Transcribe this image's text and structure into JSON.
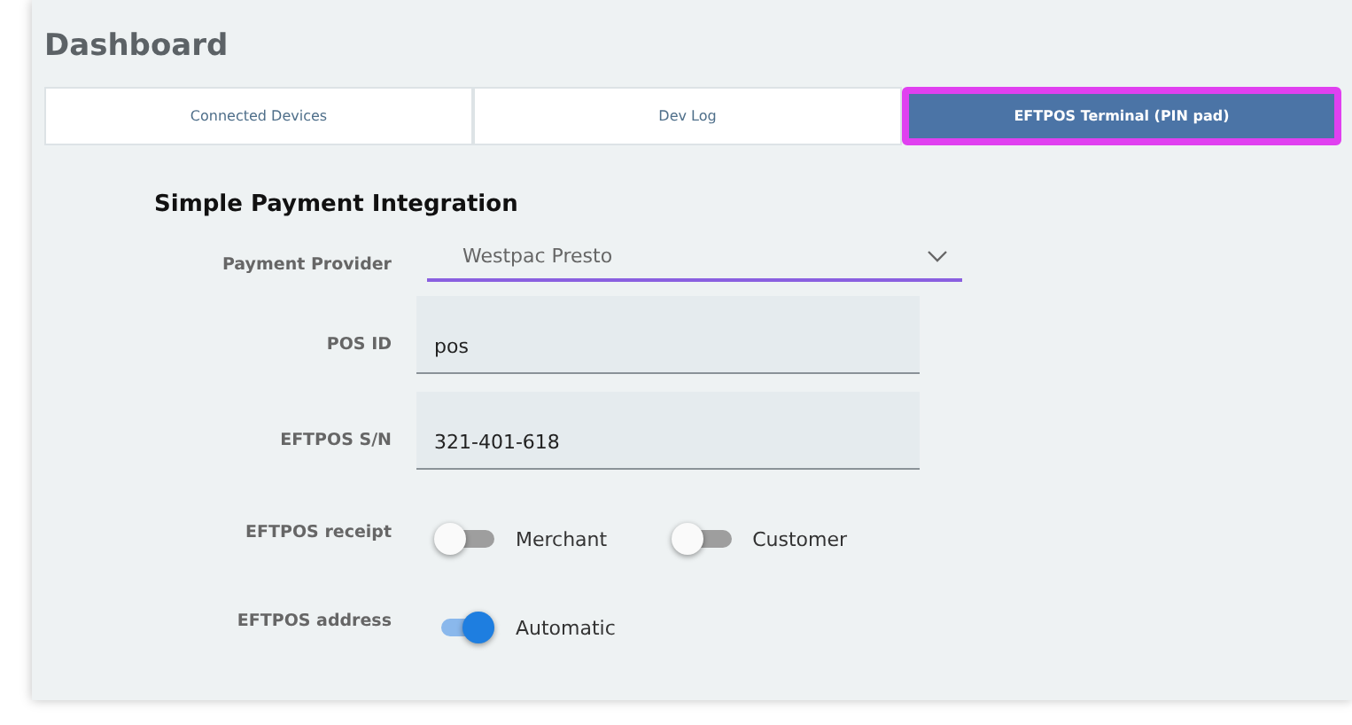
{
  "title": "Dashboard",
  "tabs": [
    {
      "label": "Connected Devices",
      "selected": false
    },
    {
      "label": "Dev Log",
      "selected": false
    },
    {
      "label": "EFTPOS Terminal (PIN pad)",
      "selected": true
    }
  ],
  "section": {
    "heading": "Simple Payment Integration",
    "fields": [
      {
        "kind": "select",
        "label": "Payment Provider",
        "value": "Westpac Presto"
      },
      {
        "kind": "text",
        "label": "POS ID",
        "value": "pos"
      },
      {
        "kind": "text",
        "label": "EFTPOS S/N",
        "value": "321-401-618"
      },
      {
        "kind": "toggles",
        "label": "EFTPOS receipt",
        "options": [
          {
            "label": "Merchant",
            "on": false
          },
          {
            "label": "Customer",
            "on": false
          }
        ]
      },
      {
        "kind": "toggles",
        "label": "EFTPOS address",
        "options": [
          {
            "label": "Automatic",
            "on": true
          }
        ]
      }
    ]
  }
}
